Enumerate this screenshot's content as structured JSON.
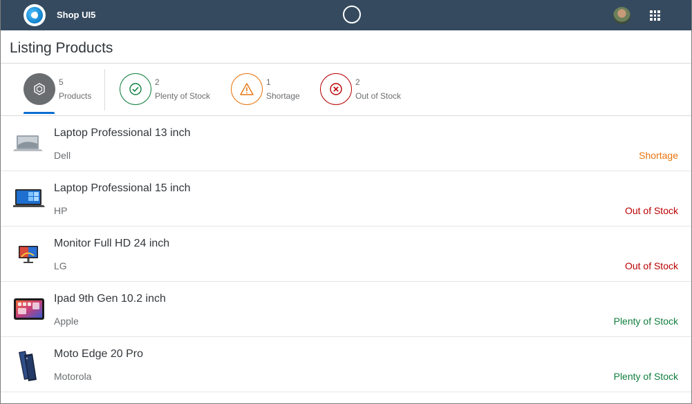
{
  "shell": {
    "title": "Shop UI5",
    "logo_icon": "ui5-logo-icon",
    "busy_icon": "busy-circle-icon",
    "avatar_icon": "user-avatar",
    "menu_icon": "product-switch-grid-icon",
    "bar_color": "#354a5f"
  },
  "page": {
    "title": "Listing Products"
  },
  "tabs": [
    {
      "count": "5",
      "label": "Products",
      "icon": "product-box-icon",
      "color": "#6a6d70",
      "selected": true
    },
    {
      "count": "2",
      "label": "Plenty of Stock",
      "icon": "checkmark-icon",
      "color": "#107e3e"
    },
    {
      "count": "1",
      "label": "Shortage",
      "icon": "warning-icon",
      "color": "#e9730c"
    },
    {
      "count": "2",
      "label": "Out of Stock",
      "icon": "error-icon",
      "color": "#bb0000"
    }
  ],
  "products": [
    {
      "name": "Laptop Professional 13 inch",
      "brand": "Dell",
      "status": "Shortage",
      "status_color": "#e9730c",
      "image": "laptop-image"
    },
    {
      "name": "Laptop Professional 15 inch",
      "brand": "HP",
      "status": "Out of Stock",
      "status_color": "#bb0000",
      "image": "laptop-image"
    },
    {
      "name": "Monitor Full HD 24 inch",
      "brand": "LG",
      "status": "Out of Stock",
      "status_color": "#bb0000",
      "image": "monitor-image"
    },
    {
      "name": "Ipad 9th Gen 10.2 inch",
      "brand": "Apple",
      "status": "Plenty of Stock",
      "status_color": "#107e3e",
      "image": "tablet-image"
    },
    {
      "name": "Moto Edge 20 Pro",
      "brand": "Motorola",
      "status": "Plenty of Stock",
      "status_color": "#107e3e",
      "image": "phone-image"
    }
  ]
}
